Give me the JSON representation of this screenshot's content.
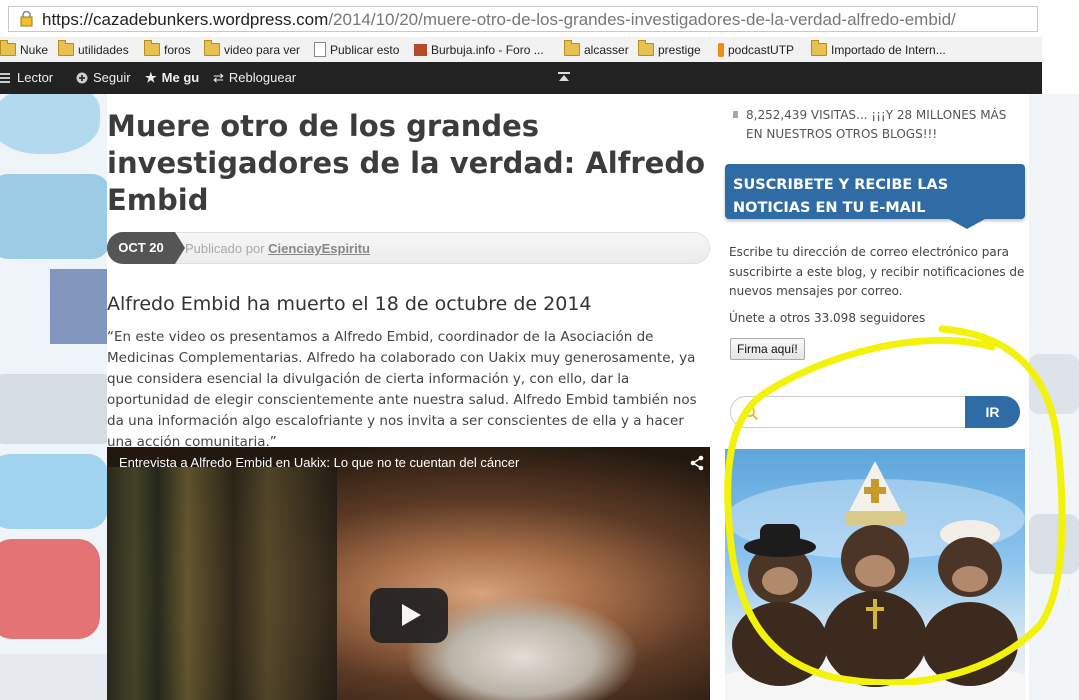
{
  "browser": {
    "url_host": "https://cazadebunkers.wordpress.com",
    "url_path": "/2014/10/20/muere-otro-de-los-grandes-investigadores-de-la-verdad-alfredo-embid/",
    "bookmarks": [
      {
        "label": "Nuke",
        "icon": "folder-icon"
      },
      {
        "label": "utilidades",
        "icon": "folder-icon"
      },
      {
        "label": "foros",
        "icon": "folder-icon"
      },
      {
        "label": "video para ver",
        "icon": "folder-icon"
      },
      {
        "label": "Publicar esto",
        "icon": "page-icon"
      },
      {
        "label": "Burbuja.info - Foro ...",
        "icon": "site-icon"
      },
      {
        "label": "alcasser",
        "icon": "folder-icon"
      },
      {
        "label": "prestige",
        "icon": "folder-icon"
      },
      {
        "label": "podcastUTP",
        "icon": "site-icon"
      },
      {
        "label": "Importado de Intern...",
        "icon": "folder-icon"
      }
    ]
  },
  "adminbar": {
    "reader": "Lector",
    "follow": "Seguir",
    "like": "Me gu",
    "reblog": "Rebloguear"
  },
  "post": {
    "title": "Muere otro de los grandes investigadores de la verdad: Alfredo Embid",
    "date": "OCT 20",
    "published_by": "Publicado por",
    "author": "CienciayEspiritu",
    "subtitle": "Alfredo Embid ha muerto el 18 de octubre de 2014",
    "body": "“En este video os presentamos a Alfredo Embid, coordinador de la Asociación de Medicinas Complementarias. Alfredo ha colaborado con Uakix muy generosamente, ya que considera esencial la divulgación de cierta información y, con ello, dar la oportunidad de elegir conscientemente ante nuestra salud. Alfredo Embid también nos da una información algo escalofriante y nos invita a ser conscientes de ella y a hacer una acción comunitaria.”",
    "video_title": "Entrevista a Alfredo Embid en Uakix: Lo que no te cuentan del cáncer"
  },
  "sidebar": {
    "visits": "8,252,439 VISITAS... ¡¡¡Y 28 MILLONES MÁS EN NUESTROS OTROS BLOGS!!!",
    "subscribe_title": "SUSCRIBETE Y RECIBE LAS NOTICIAS EN TU E-MAIL",
    "subscribe_desc": "Escribe tu dirección de correo electrónico para suscribirte a este blog, y recibir notificaciones de nuevos mensajes por correo.",
    "followers": "Únete a otros 33.098 seguidores",
    "subscribe_button": "Firma aquí!",
    "search_button": "IR"
  },
  "colors": {
    "accent_blue": "#2f6ca6",
    "highlight_yellow": "#f2f20a",
    "adminbar_bg": "#222222"
  }
}
